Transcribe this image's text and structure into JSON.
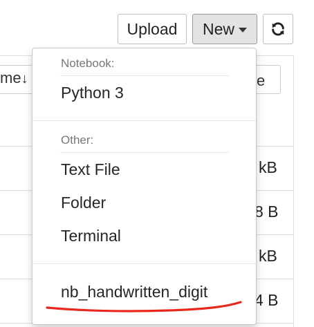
{
  "toolbar": {
    "upload_label": "Upload",
    "new_label": "New",
    "refresh_icon": "refresh-icon"
  },
  "file_list": {
    "name_header_fragment": "me",
    "size_header_fragment": "ze",
    "size_cells": [
      "kB",
      "8 B",
      "kB",
      "4 B"
    ]
  },
  "new_menu": {
    "notebook_header": "Notebook:",
    "notebook_items": [
      "Python 3"
    ],
    "other_header": "Other:",
    "other_items": [
      "Text File",
      "Folder",
      "Terminal"
    ],
    "extra_item": "nb_handwritten_digit"
  },
  "colors": {
    "annotation_underline": "#e8281c",
    "new_button_bg": "#e3e3e3"
  }
}
